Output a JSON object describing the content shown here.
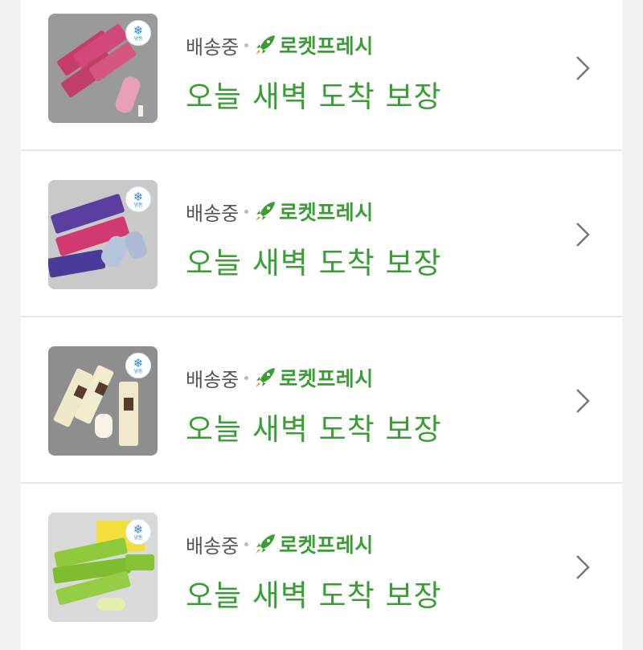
{
  "accent_color": "#3a9e35",
  "orders": [
    {
      "status": "배송중",
      "service": "로켓프레시",
      "promise": "오늘 새벽 도착 보장",
      "badge": "냉동",
      "product_colors": [
        "#c73d6a",
        "#e8a0b6",
        "#ffffff"
      ]
    },
    {
      "status": "배송중",
      "service": "로켓프레시",
      "promise": "오늘 새벽 도착 보장",
      "badge": "냉동",
      "product_colors": [
        "#5b3fa0",
        "#d23a6f",
        "#b8c4dc"
      ]
    },
    {
      "status": "배송중",
      "service": "로켓프레시",
      "promise": "오늘 새벽 도착 보장",
      "badge": "냉동",
      "product_colors": [
        "#efe9c9",
        "#5a3a2a",
        "#f7f3e6"
      ]
    },
    {
      "status": "배송중",
      "service": "로켓프레시",
      "promise": "오늘 새벽 도착 보장",
      "badge": "냉동",
      "product_colors": [
        "#8fc93c",
        "#f2df3c",
        "#e4efb2"
      ]
    }
  ]
}
